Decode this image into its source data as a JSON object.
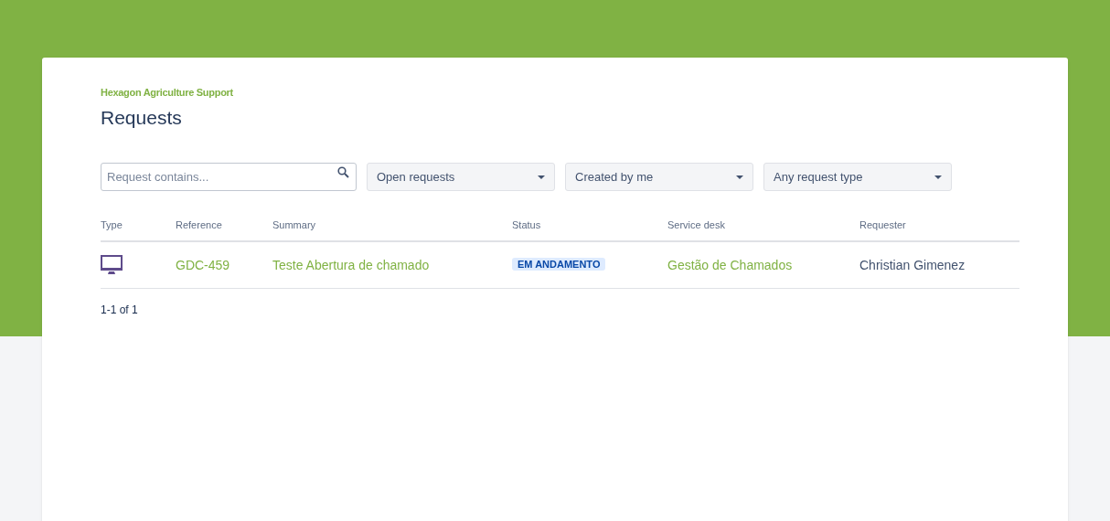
{
  "header": {
    "portal": "Hexagon Agriculture Support",
    "title": "Requests"
  },
  "filters": {
    "search": {
      "placeholder": "Request contains..."
    },
    "dropdowns": [
      {
        "value": "Open requests"
      },
      {
        "value": "Created by me"
      },
      {
        "value": "Any request type"
      }
    ]
  },
  "table": {
    "columns": [
      "Type",
      "Reference",
      "Summary",
      "Status",
      "Service desk",
      "Requester"
    ],
    "rows": [
      {
        "reference": "GDC-459",
        "summary": "Teste Abertura de chamado",
        "status": "EM ANDAMENTO",
        "service_desk": "Gestão de Chamados",
        "requester": "Christian Gimenez"
      }
    ]
  },
  "pagination": "1-1 of 1"
}
